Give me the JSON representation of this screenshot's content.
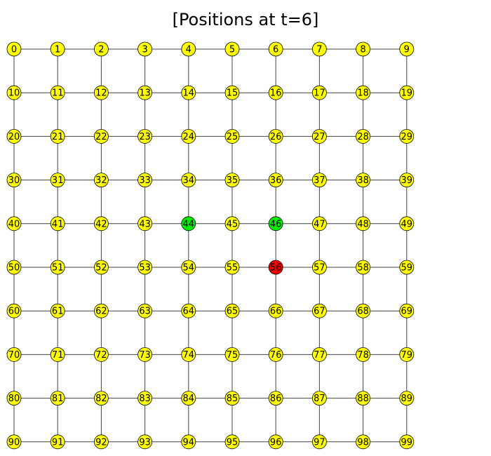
{
  "title": "[Positions at t=6]",
  "grid": {
    "rows": 10,
    "cols": 10,
    "node_labels": [
      "0",
      "1",
      "2",
      "3",
      "4",
      "5",
      "6",
      "7",
      "8",
      "9",
      "10",
      "11",
      "12",
      "13",
      "14",
      "15",
      "16",
      "17",
      "18",
      "19",
      "20",
      "21",
      "22",
      "23",
      "24",
      "25",
      "26",
      "27",
      "28",
      "29",
      "30",
      "31",
      "32",
      "33",
      "34",
      "35",
      "36",
      "37",
      "38",
      "39",
      "40",
      "41",
      "42",
      "43",
      "44",
      "45",
      "46",
      "47",
      "48",
      "49",
      "50",
      "51",
      "52",
      "53",
      "54",
      "55",
      "56",
      "57",
      "58",
      "59",
      "60",
      "61",
      "62",
      "63",
      "64",
      "65",
      "66",
      "67",
      "68",
      "69",
      "70",
      "71",
      "72",
      "73",
      "74",
      "75",
      "76",
      "77",
      "78",
      "79",
      "80",
      "81",
      "82",
      "83",
      "84",
      "85",
      "86",
      "87",
      "88",
      "89",
      "90",
      "91",
      "92",
      "93",
      "94",
      "95",
      "96",
      "97",
      "98",
      "99"
    ],
    "green_nodes": [
      44,
      46
    ],
    "red_nodes": [
      56
    ]
  },
  "colors": {
    "default_node": "#ffff00",
    "green_node": "#00ee00",
    "red_node": "#ee0000",
    "edge": "#444444",
    "node_stroke": "#000000",
    "label": "#000000"
  }
}
